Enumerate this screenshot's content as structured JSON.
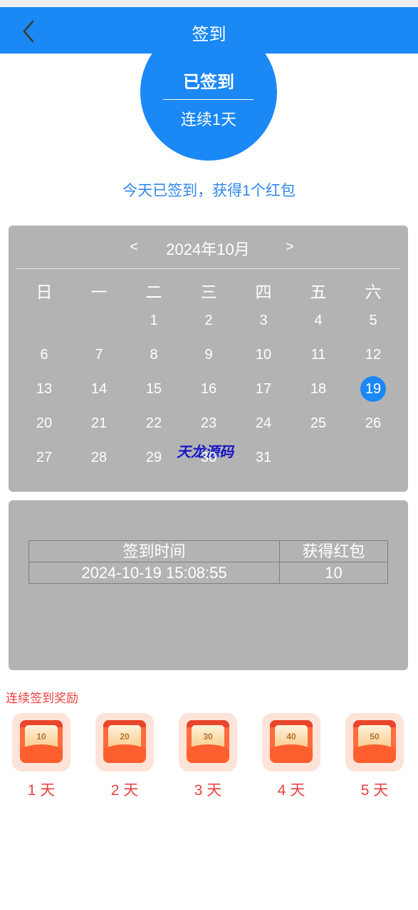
{
  "nav": {
    "title": "签到",
    "back_icon": "chevron-left-icon"
  },
  "status": {
    "signed_label": "已签到",
    "streak_label": "连续1天",
    "tip": "今天已签到，获得1个红包"
  },
  "calendar": {
    "prev_label": "<",
    "next_label": ">",
    "title": "2024年10月",
    "weekdays": [
      "日",
      "一",
      "二",
      "三",
      "四",
      "五",
      "六"
    ],
    "first_weekday": 2,
    "days_in_month": 31,
    "today": 19,
    "watermark": "天龙源码"
  },
  "records": {
    "headers": [
      "签到时间",
      "获得红包"
    ],
    "rows": [
      [
        "2024-10-19 15:08:55",
        "10"
      ]
    ]
  },
  "rewards": {
    "title": "连续签到奖励",
    "items": [
      {
        "amount": "10",
        "label": "1 天"
      },
      {
        "amount": "20",
        "label": "2 天"
      },
      {
        "amount": "30",
        "label": "3 天"
      },
      {
        "amount": "40",
        "label": "4 天"
      },
      {
        "amount": "50",
        "label": "5 天"
      }
    ]
  },
  "colors": {
    "primary": "#1a88f5",
    "panel": "#b3b3b3",
    "reward_text": "#e94141",
    "tip_text": "#2f88e8"
  }
}
